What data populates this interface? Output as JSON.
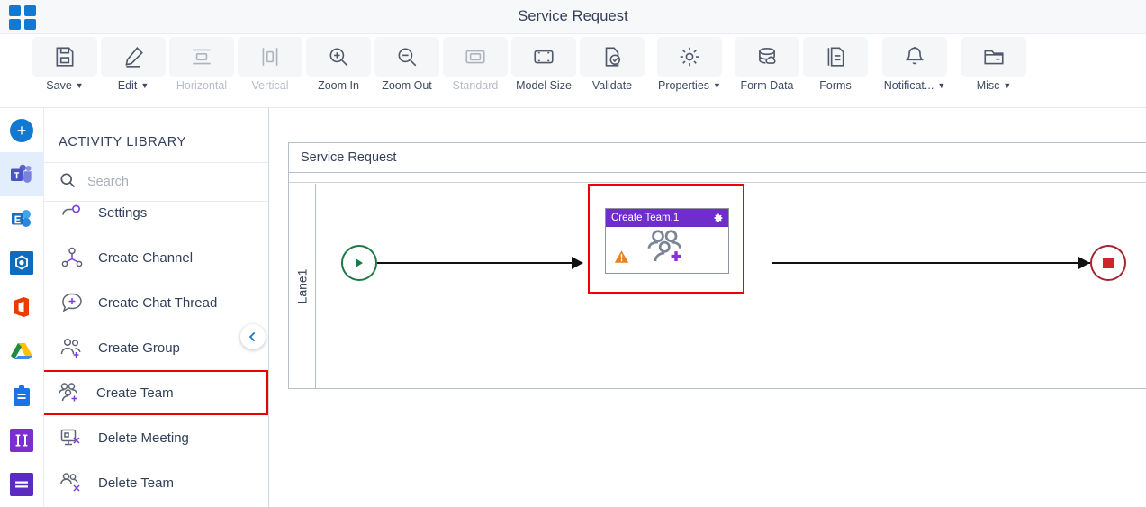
{
  "titlebar": {
    "logo_icon": "grid-squares-icon",
    "title": "Service Request"
  },
  "toolbar": {
    "items": [
      {
        "label": "Save",
        "icon": "save-floppy-icon",
        "caret": true,
        "disabled": false
      },
      {
        "label": "Edit",
        "icon": "pencil-edit-icon",
        "caret": true,
        "disabled": false
      },
      {
        "label": "Horizontal",
        "icon": "horizontal-align-icon",
        "caret": false,
        "disabled": true
      },
      {
        "label": "Vertical",
        "icon": "vertical-align-icon",
        "caret": false,
        "disabled": true
      },
      {
        "label": "Zoom In",
        "icon": "zoom-in-icon",
        "caret": false,
        "disabled": false
      },
      {
        "label": "Zoom Out",
        "icon": "zoom-out-icon",
        "caret": false,
        "disabled": false
      },
      {
        "label": "Standard",
        "icon": "standard-size-icon",
        "caret": false,
        "disabled": true
      },
      {
        "label": "Model Size",
        "icon": "model-size-icon",
        "caret": false,
        "disabled": false
      },
      {
        "label": "Validate",
        "icon": "validate-check-icon",
        "caret": false,
        "disabled": false
      },
      {
        "label": "Properties",
        "icon": "gear-icon",
        "caret": true,
        "disabled": false
      },
      {
        "label": "Form Data",
        "icon": "database-cloud-icon",
        "caret": false,
        "disabled": false
      },
      {
        "label": "Forms",
        "icon": "document-copy-icon",
        "caret": false,
        "disabled": false
      },
      {
        "label": "Notificat...",
        "icon": "bell-icon",
        "caret": true,
        "disabled": false
      },
      {
        "label": "Misc",
        "icon": "folder-icon",
        "caret": true,
        "disabled": false
      }
    ]
  },
  "rail": {
    "items": [
      {
        "name": "add-button",
        "icon": "plus-circle-icon",
        "active": false
      },
      {
        "name": "microsoft-teams",
        "icon": "ms-teams-icon",
        "active": true
      },
      {
        "name": "microsoft-exchange",
        "icon": "ms-exchange-icon",
        "active": false
      },
      {
        "name": "blue-hexagon-app",
        "icon": "hexagon-gem-icon",
        "active": false
      },
      {
        "name": "microsoft-office",
        "icon": "ms-office-icon",
        "active": false
      },
      {
        "name": "google-drive",
        "icon": "google-drive-icon",
        "active": false
      },
      {
        "name": "clipboard-tasks",
        "icon": "clipboard-icon",
        "active": false
      },
      {
        "name": "columns-app",
        "icon": "columns-icon",
        "active": false
      },
      {
        "name": "list-app",
        "icon": "list-lines-icon",
        "active": false
      }
    ]
  },
  "panel": {
    "title": "ACTIVITY LIBRARY",
    "search": {
      "value": "",
      "placeholder": "Search",
      "icon": "search-icon"
    },
    "collapse_icon": "chevron-left-icon",
    "activities": [
      {
        "label": "Settings",
        "icon": "settings-activity-icon",
        "selected": false,
        "clipped": true
      },
      {
        "label": "Create Channel",
        "icon": "create-channel-icon",
        "selected": false,
        "clipped": false
      },
      {
        "label": "Create Chat Thread",
        "icon": "create-chat-thread-icon",
        "selected": false,
        "clipped": false
      },
      {
        "label": "Create Group",
        "icon": "create-group-icon",
        "selected": false,
        "clipped": false
      },
      {
        "label": "Create Team",
        "icon": "create-team-icon",
        "selected": true,
        "clipped": false
      },
      {
        "label": "Delete Meeting",
        "icon": "delete-meeting-icon",
        "selected": false,
        "clipped": false
      },
      {
        "label": "Delete Team",
        "icon": "delete-team-icon",
        "selected": false,
        "clipped": false
      }
    ]
  },
  "canvas": {
    "pool_title": "Service Request",
    "lane_label": "Lane1",
    "start_event": {
      "icon": "start-play-icon",
      "color": "#1e7a45"
    },
    "end_event": {
      "icon": "end-stop-icon",
      "color": "#a52431"
    },
    "node": {
      "title": "Create Team.1",
      "header_color": "#6f2ecb",
      "gear_icon": "gear-icon",
      "warning_icon": "warning-triangle-icon",
      "glyph_icon": "create-team-icon",
      "selected": true,
      "selection_color": "#ee0000"
    }
  }
}
